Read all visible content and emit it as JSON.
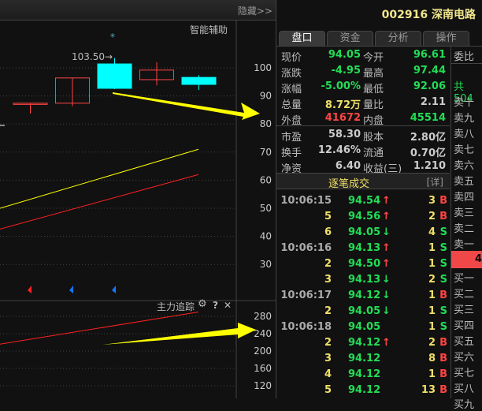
{
  "topbar": {
    "hide_label": "隐藏>>"
  },
  "chart": {
    "assist_label": "智能辅助",
    "peak_label": "103.50→",
    "price_axis": [
      "100",
      "90",
      "80",
      "70",
      "60",
      "50",
      "40",
      "30"
    ],
    "price_ticks": [
      100,
      90,
      80,
      70,
      60,
      50,
      40,
      30
    ],
    "candles": [
      {
        "o": 87.4,
        "c": 87.4,
        "h": 87.4,
        "l": 83.7,
        "color": "#ff4444",
        "fill": false
      },
      {
        "o": 87.4,
        "c": 96.4,
        "h": 96.4,
        "l": 86.3,
        "color": "#ff4444",
        "fill": false
      },
      {
        "o": 101.4,
        "c": 92.7,
        "h": 103.5,
        "l": 92.4,
        "color": "#00ffff",
        "fill": true
      },
      {
        "o": 95.8,
        "c": 99.2,
        "h": 102,
        "l": 93.8,
        "color": "#ff4444",
        "fill": false
      },
      {
        "o": 96.6,
        "c": 94.1,
        "h": 97.4,
        "l": 92.1,
        "color": "#00ffff",
        "fill": true
      }
    ],
    "ma_yellow": [
      50,
      71
    ],
    "ma_red": [
      42.6,
      62
    ],
    "sub_title": "主力追踪",
    "sub_icons": [
      "gear-icon",
      "help-icon",
      "close-icon"
    ],
    "sub_help": "?",
    "sub_close": "✕",
    "sub_axis": [
      "280",
      "240",
      "200",
      "160",
      "120"
    ],
    "sub_ticks": [
      280,
      240,
      200,
      160,
      120
    ],
    "sub_line": [
      216,
      290
    ]
  },
  "header": {
    "stock": "002916 深南电路"
  },
  "tabs": [
    "盘口",
    "资金",
    "分析",
    "操作"
  ],
  "quote": [
    {
      "l1": "现价",
      "v1": "94.05",
      "c1": "g",
      "l2": "今开",
      "v2": "96.61",
      "c2": "g"
    },
    {
      "l1": "涨跌",
      "v1": "-4.95",
      "c1": "g",
      "l2": "最高",
      "v2": "97.44",
      "c2": "g"
    },
    {
      "l1": "涨幅",
      "v1": "-5.00%",
      "c1": "g",
      "l2": "最低",
      "v2": "92.06",
      "c2": "g"
    },
    {
      "l1": "总量",
      "v1": "8.72万",
      "c1": "y",
      "l2": "量比",
      "v2": "2.11",
      "c2": "w"
    },
    {
      "l1": "外盘",
      "v1": "41672",
      "c1": "r",
      "l2": "内盘",
      "v2": "45514",
      "c2": "g"
    }
  ],
  "fund": [
    {
      "l1": "市盈",
      "v1": "58.30",
      "c1": "w",
      "l2": "股本",
      "v2": "2.80亿",
      "c2": "w"
    },
    {
      "l1": "换手",
      "v1": "12.46%",
      "c1": "w",
      "l2": "流通",
      "v2": "0.70亿",
      "c2": "w"
    },
    {
      "l1": "净资",
      "v1": "6.40",
      "c1": "w",
      "l2": "收益(三)",
      "v2": "1.210",
      "c2": "w"
    }
  ],
  "ticks": {
    "title": "逐笔成交",
    "detail": "[详]",
    "rows": [
      {
        "t": "10:06:15",
        "p": "94.54",
        "a": "↑",
        "v": "3",
        "bs": "B"
      },
      {
        "t": "5",
        "p": "94.56",
        "a": "↑",
        "v": "2",
        "bs": "B"
      },
      {
        "t": "6",
        "p": "94.05",
        "a": "↓",
        "v": "4",
        "bs": "S"
      },
      {
        "t": "10:06:16",
        "p": "94.13",
        "a": "↑",
        "v": "1",
        "bs": "S"
      },
      {
        "t": "2",
        "p": "94.50",
        "a": "↑",
        "v": "1",
        "bs": "S"
      },
      {
        "t": "3",
        "p": "94.13",
        "a": "↓",
        "v": "2",
        "bs": "S"
      },
      {
        "t": "10:06:17",
        "p": "94.12",
        "a": "↓",
        "v": "1",
        "bs": "B"
      },
      {
        "t": "2",
        "p": "94.05",
        "a": "↓",
        "v": "1",
        "bs": "S"
      },
      {
        "t": "10:06:18",
        "p": "94.05",
        "a": "",
        "v": "1",
        "bs": "S"
      },
      {
        "t": "2",
        "p": "94.12",
        "a": "↑",
        "v": "2",
        "bs": "B"
      },
      {
        "t": "3",
        "p": "94.12",
        "a": "",
        "v": "8",
        "bs": "B"
      },
      {
        "t": "4",
        "p": "94.12",
        "a": "",
        "v": "1",
        "bs": "B"
      },
      {
        "t": "5",
        "p": "94.12",
        "a": "",
        "v": "13",
        "bs": "B"
      }
    ]
  },
  "orderbook": {
    "ratio_label": "委比",
    "total": "共504",
    "sell": [
      "卖十",
      "卖九",
      "卖八",
      "卖七",
      "卖六",
      "卖五",
      "卖四",
      "卖三",
      "卖二",
      "卖一"
    ],
    "mid": "4",
    "buy": [
      "买一",
      "买二",
      "买三",
      "买四",
      "买五",
      "买六",
      "买七",
      "买八",
      "买九"
    ]
  }
}
